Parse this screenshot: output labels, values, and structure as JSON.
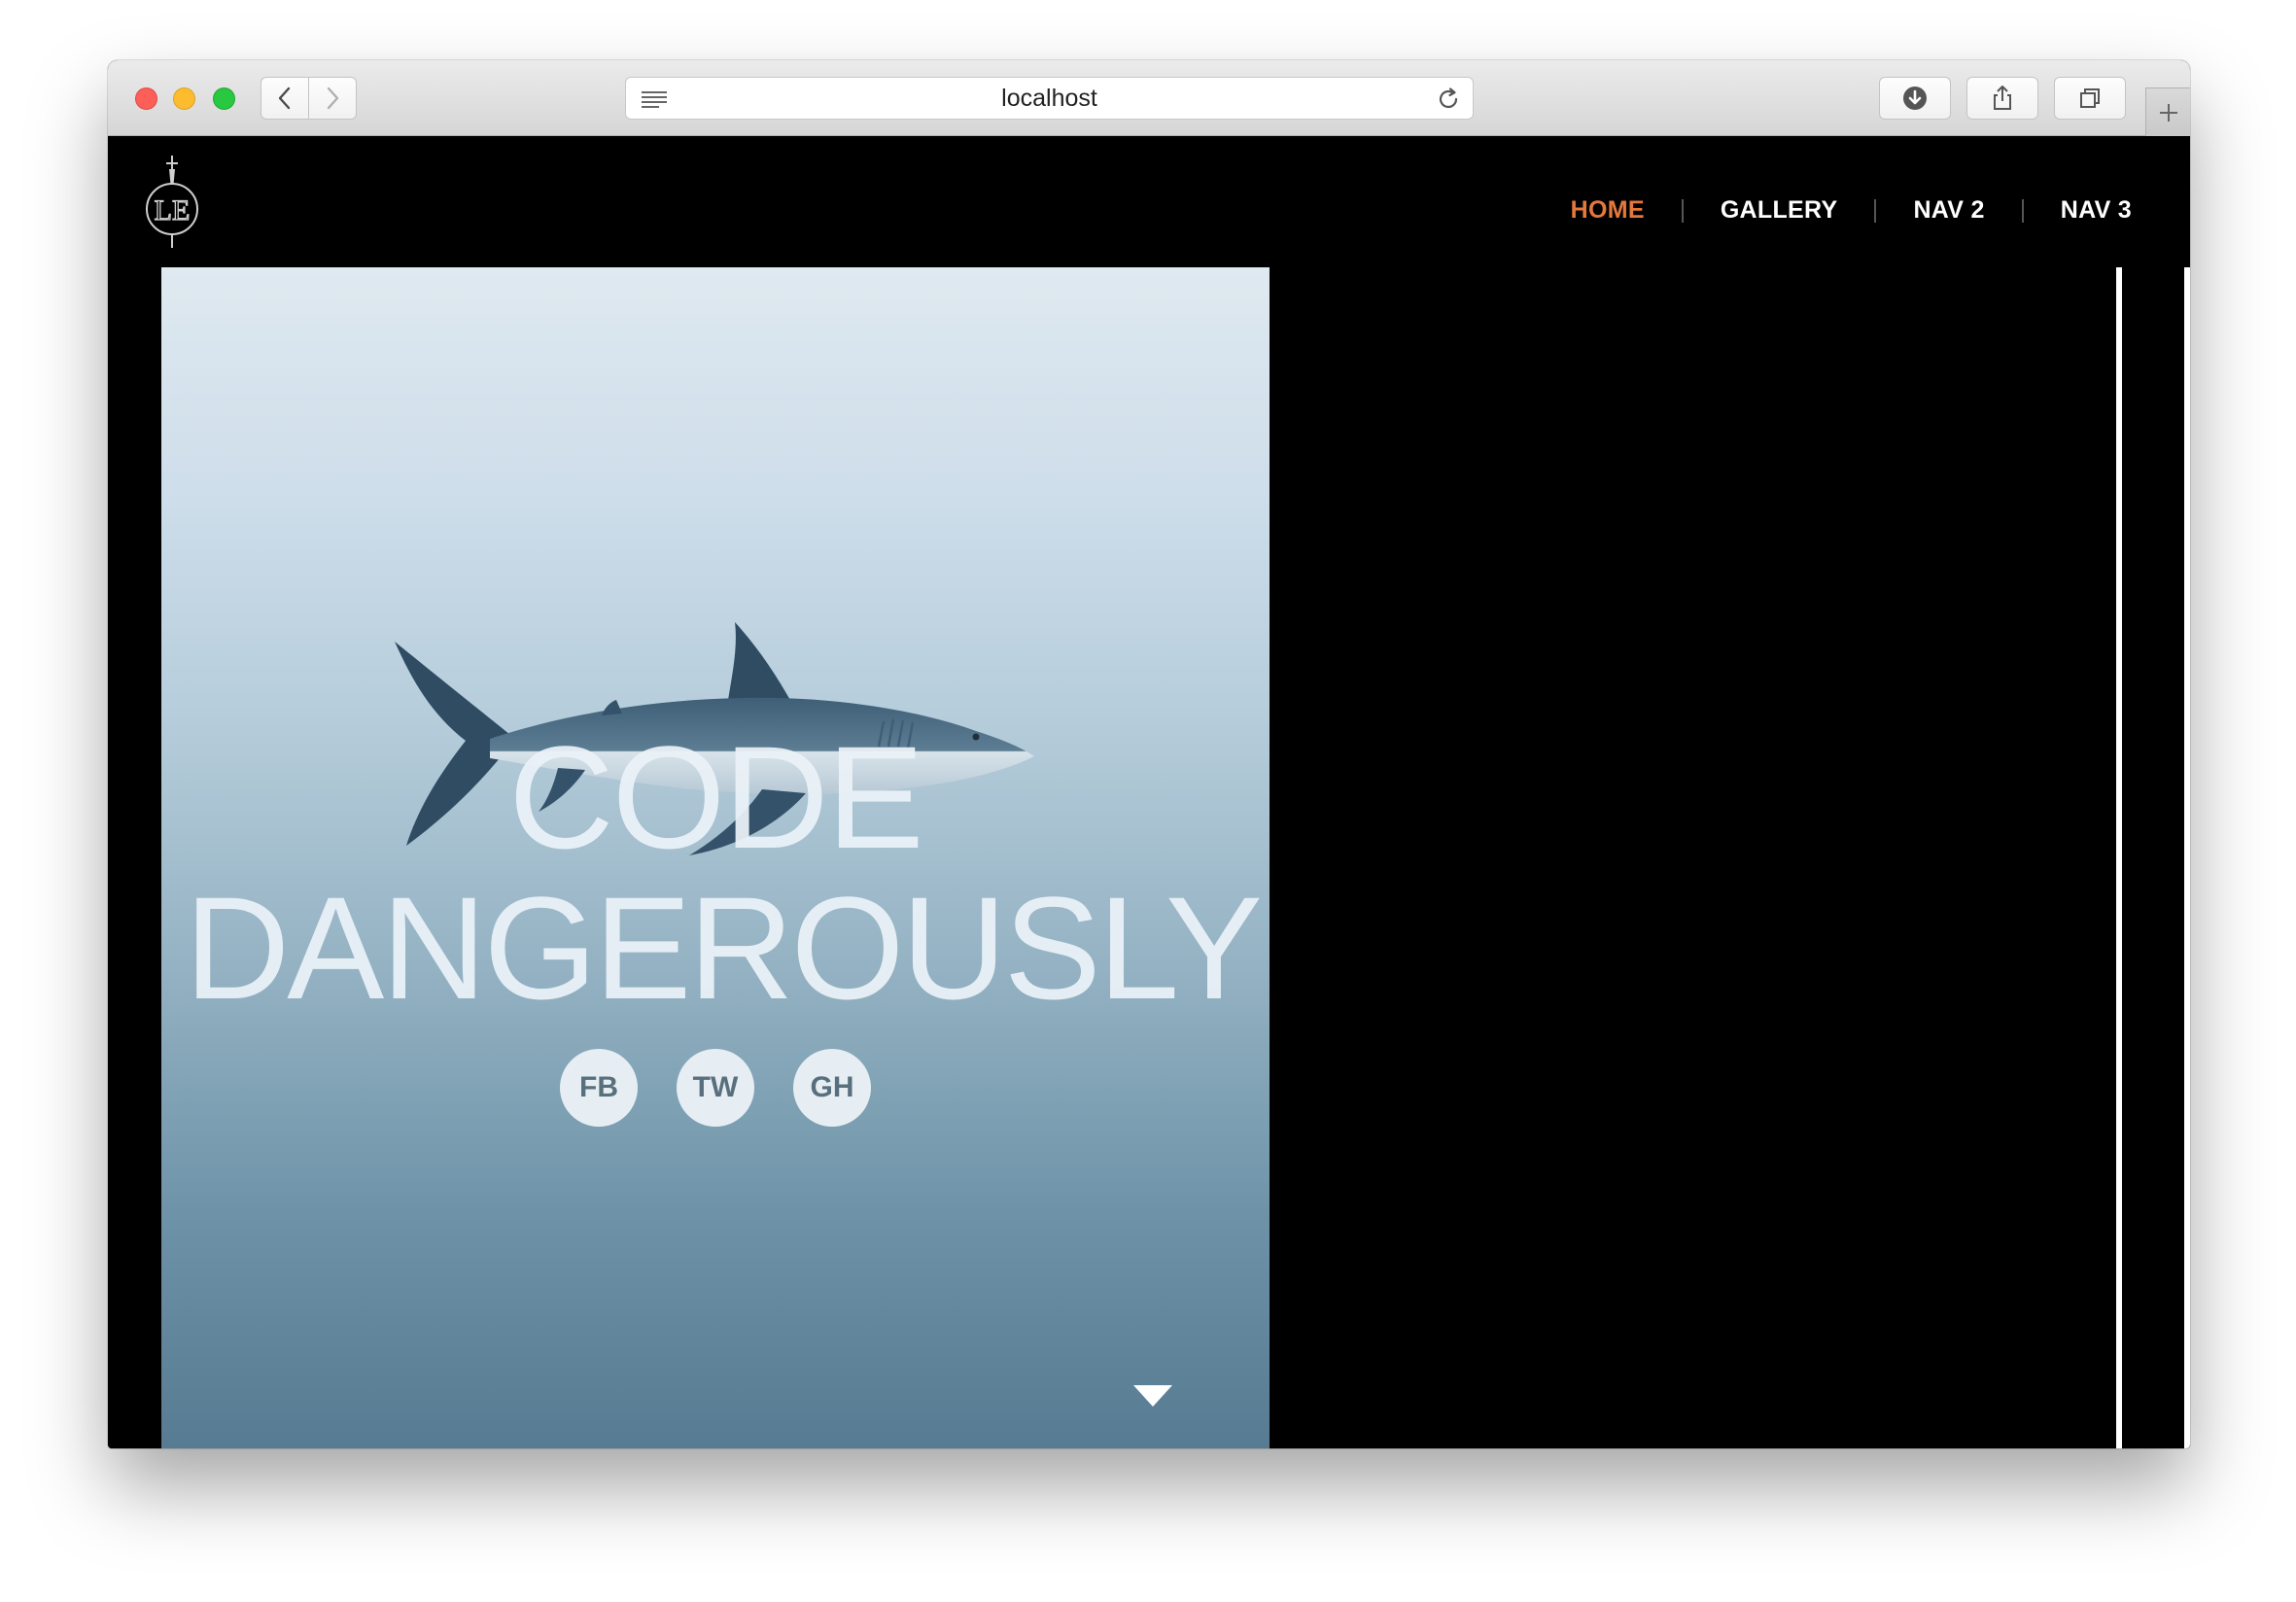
{
  "browser": {
    "url": "localhost",
    "back_icon": "chevron-left-icon",
    "forward_icon": "chevron-right-icon",
    "reader_icon": "reader-view-icon",
    "reload_icon": "reload-icon",
    "download_icon": "download-icon",
    "share_icon": "share-icon",
    "tabs_icon": "tabs-overview-icon",
    "new_tab_icon": "plus-icon"
  },
  "site": {
    "logo": "LE",
    "nav": [
      {
        "label": "HOME",
        "active": true
      },
      {
        "label": "GALLERY",
        "active": false
      },
      {
        "label": "NAV 2",
        "active": false
      },
      {
        "label": "NAV 3",
        "active": false
      }
    ],
    "accent_color": "#e5783a"
  },
  "hero": {
    "headline_line1": "CODE",
    "headline_line2": "DANGEROUSLY",
    "socials": [
      {
        "label": "FB"
      },
      {
        "label": "TW"
      },
      {
        "label": "GH"
      }
    ],
    "scroll_icon": "triangle-down-icon"
  }
}
